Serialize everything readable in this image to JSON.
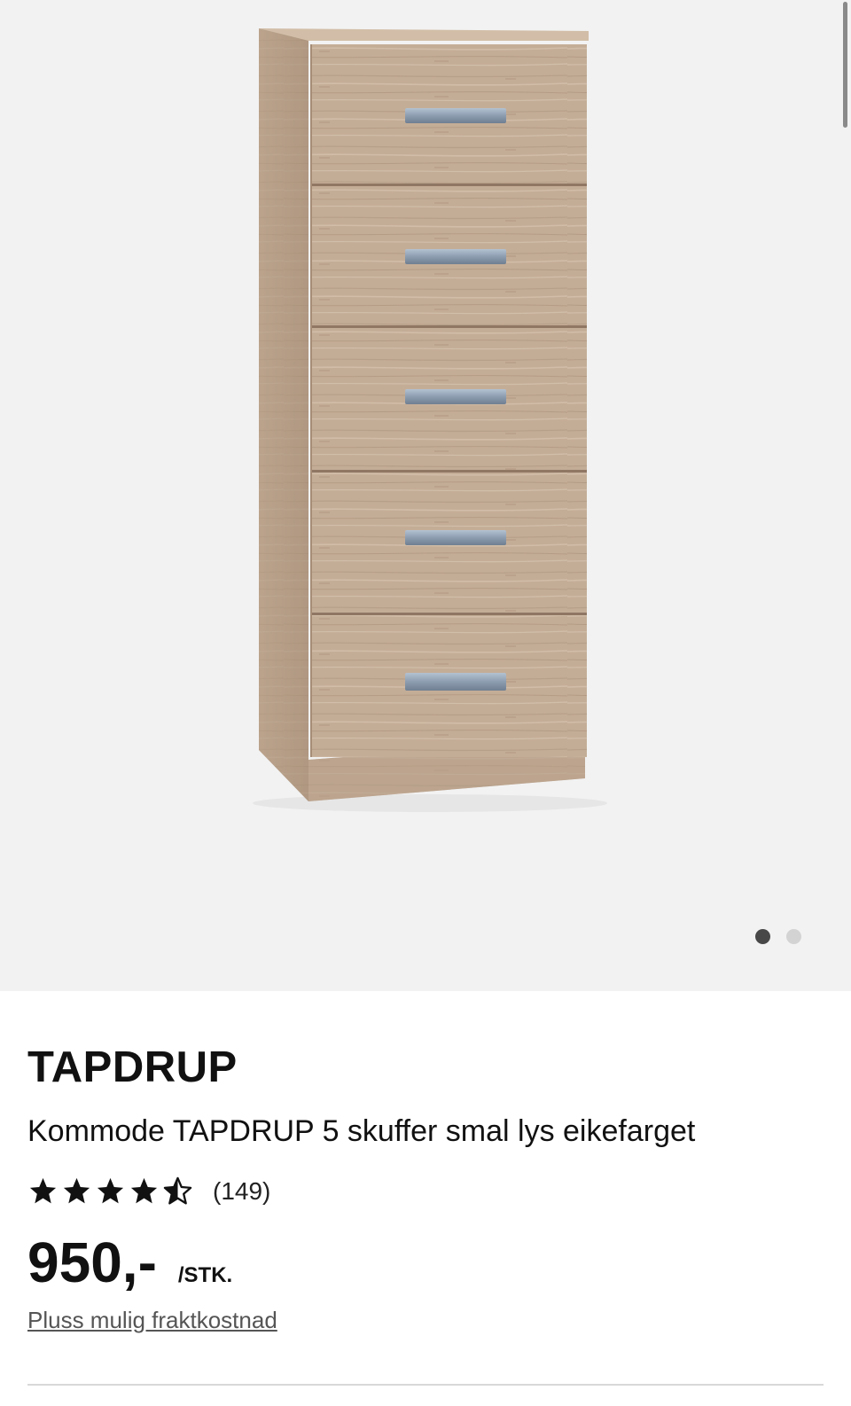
{
  "gallery": {
    "image_alt": "Kommode TAPDRUP 5 skuffer smal lys eikefarget",
    "slide_count": 2,
    "active_slide": 1
  },
  "product": {
    "brand": "TAPDRUP",
    "description": "Kommode TAPDRUP 5 skuffer smal lys eikefarget",
    "rating": {
      "value": 4.5,
      "max": 5,
      "count_label": "(149)"
    },
    "price": "950,-",
    "unit": "/STK.",
    "shipping_link": "Pluss mulig fraktkostnad"
  },
  "colors": {
    "gallery_background": "#f2f2f2",
    "text": "#111111",
    "link": "#555555",
    "dot_active": "#484848",
    "dot_inactive": "#d3d3d3"
  }
}
